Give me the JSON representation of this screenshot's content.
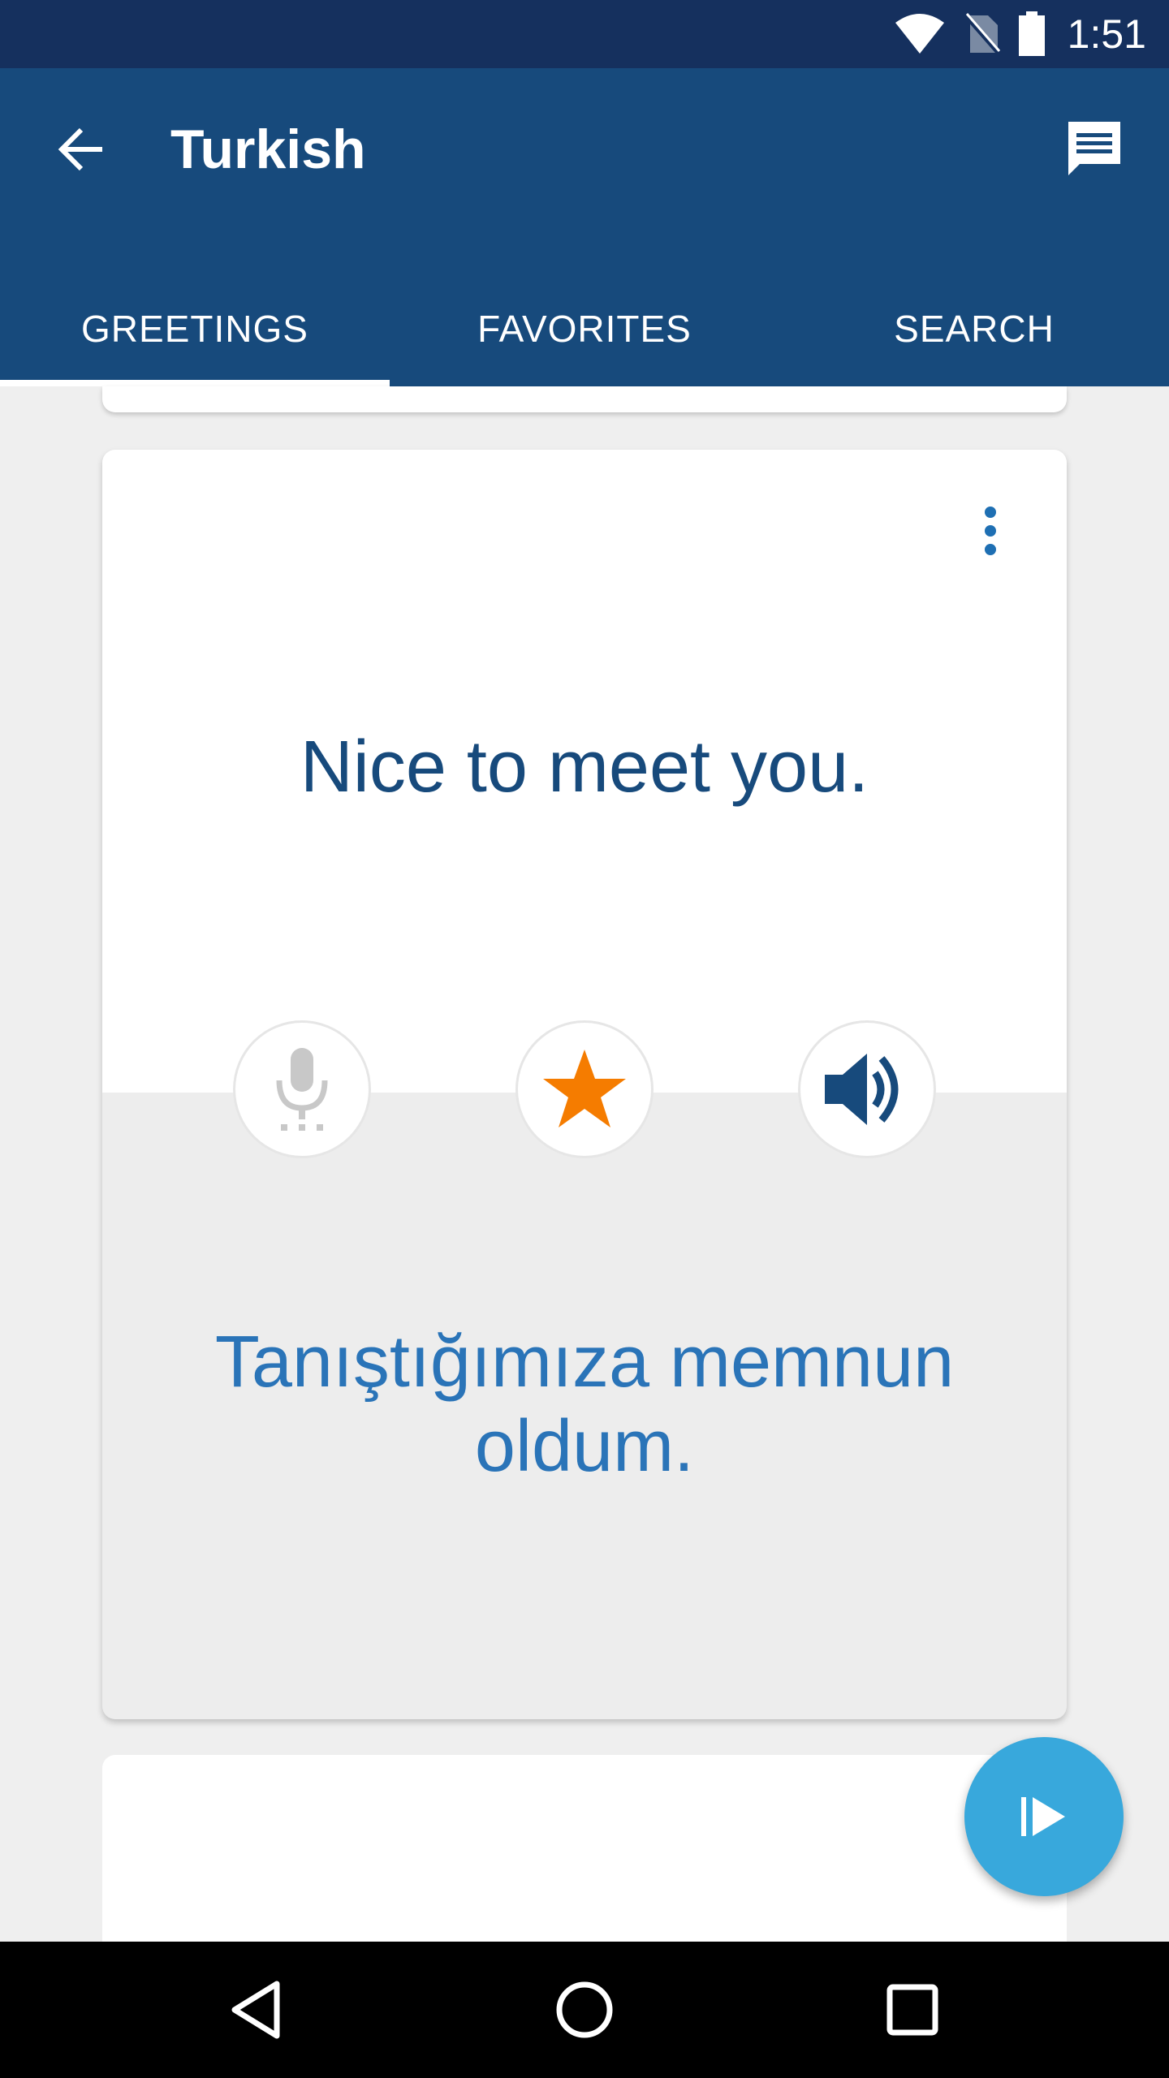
{
  "status_bar": {
    "time": "1:51",
    "icons": [
      "wifi-icon",
      "no-sim-icon",
      "battery-icon"
    ]
  },
  "app_bar": {
    "title": "Turkish",
    "back_icon": "arrow-back-icon",
    "action_icon": "chat-icon"
  },
  "tabs": [
    {
      "label": "GREETINGS",
      "active": true
    },
    {
      "label": "FAVORITES",
      "active": false
    },
    {
      "label": "SEARCH",
      "active": false
    }
  ],
  "card": {
    "menu_icon": "more-vert-icon",
    "phrase": "Nice to meet you.",
    "translation": "Tanıştığımıza memnun oldum.",
    "actions": [
      {
        "icon": "microphone-icon",
        "enabled": false
      },
      {
        "icon": "star-icon",
        "active": true
      },
      {
        "icon": "speaker-icon",
        "enabled": true
      }
    ]
  },
  "fab": {
    "icon": "play-icon"
  },
  "colors": {
    "status_bar": "#15305e",
    "app_bar": "#174a7c",
    "phrase_text": "#174a7c",
    "translation_text": "#2a74b8",
    "star": "#f57c00",
    "fab": "#38a8dc"
  },
  "nav_bar": [
    "back-triangle-icon",
    "home-circle-icon",
    "recents-square-icon"
  ]
}
